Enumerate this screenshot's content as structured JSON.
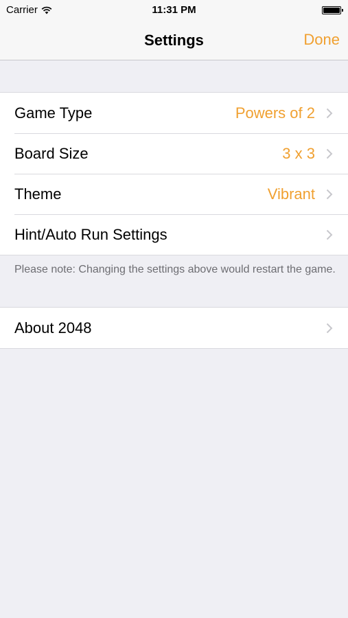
{
  "status_bar": {
    "carrier": "Carrier",
    "time": "11:31 PM",
    "wifi_icon": "wifi-icon",
    "battery_icon": "battery-icon"
  },
  "nav": {
    "title": "Settings",
    "done_label": "Done"
  },
  "settings": [
    {
      "label": "Game Type",
      "value": "Powers of 2"
    },
    {
      "label": "Board Size",
      "value": "3 x 3"
    },
    {
      "label": "Theme",
      "value": "Vibrant"
    },
    {
      "label": "Hint/Auto Run Settings",
      "value": ""
    }
  ],
  "note": "Please note: Changing the settings above would restart the game.",
  "about": {
    "label": "About 2048"
  },
  "colors": {
    "accent": "#f0a030",
    "background": "#efeff4",
    "bar": "#f7f7f7"
  }
}
